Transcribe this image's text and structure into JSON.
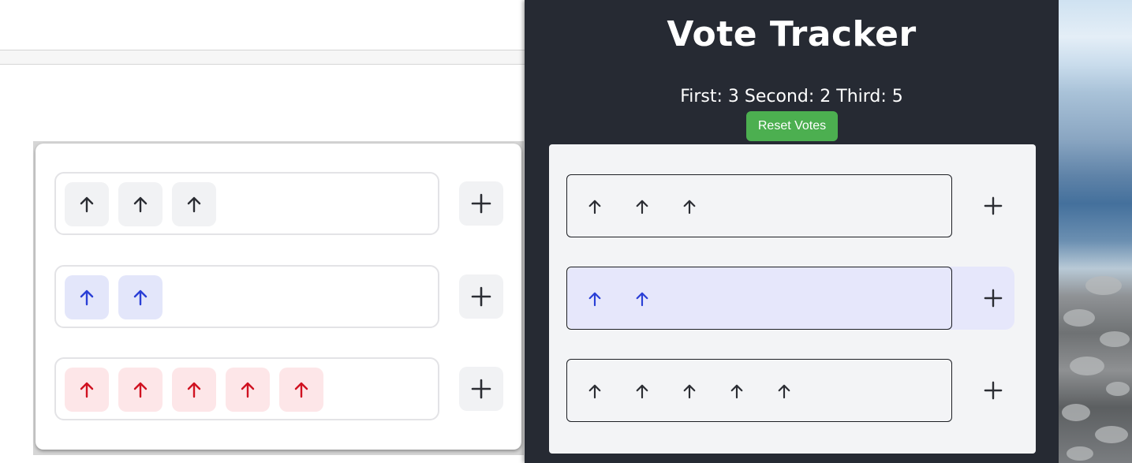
{
  "app": {
    "title": "Vote Tracker",
    "counts_text": "First: 3 Second: 2 Third: 5",
    "reset_label": "Reset Votes"
  },
  "colors": {
    "panel_bg": "#262a33",
    "reset_button": "#4caf50",
    "vote_blue": "#2a3fd6",
    "vote_red": "#d01221",
    "selected_row": "#e6e7fb"
  },
  "counts": {
    "first": 3,
    "second": 2,
    "third": 5
  },
  "left_preview": {
    "rows": [
      {
        "votes": 3,
        "color": "neutral",
        "icon": "arrow-up-icon"
      },
      {
        "votes": 2,
        "color": "blue",
        "icon": "arrow-up-icon"
      },
      {
        "votes": 5,
        "color": "red",
        "icon": "arrow-up-icon"
      }
    ],
    "add_icon": "plus-icon"
  },
  "panel_rows": [
    {
      "votes": 3,
      "color": "neutral",
      "selected": false
    },
    {
      "votes": 2,
      "color": "blue",
      "selected": true
    },
    {
      "votes": 5,
      "color": "neutral",
      "selected": false
    }
  ]
}
